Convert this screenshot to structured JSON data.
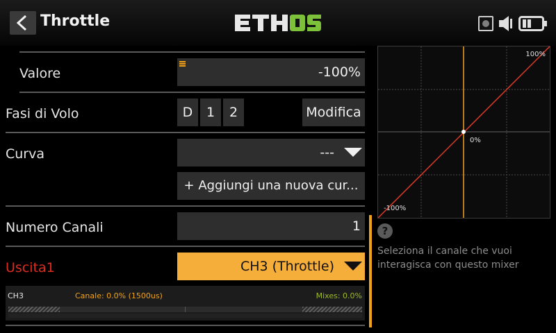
{
  "header": {
    "title": "Throttle",
    "logo_text": "ETHOS"
  },
  "form": {
    "value_label": "Valore",
    "value": "-100%",
    "flight_modes_label": "Fasi di Volo",
    "flight_modes": [
      "D",
      "1",
      "2"
    ],
    "edit_button": "Modifica",
    "curve_label": "Curva",
    "curve_value": "---",
    "add_curve_button": "+ Aggiungi una nuova cur...",
    "channel_count_label": "Numero Canali",
    "channel_count": "1",
    "output_label": "Uscita1",
    "output_value": "CH3 (Throttle)"
  },
  "monitor": {
    "channel": "CH3",
    "channel_value": "Canale: 0.0% (1500us)",
    "mixes_value": "Mixes: 0.0%"
  },
  "curve_preview": {
    "max_label": "100%",
    "center_label": "0%",
    "min_label": "-100%"
  },
  "help": {
    "icon_glyph": "?",
    "text": "Seleziona il canale che vuoi interagisca con questo mixer"
  },
  "colors": {
    "accent": "#f6ae3a",
    "error_label": "#e02b20",
    "curve_line": "#e03a2a",
    "logo_green": "#7dc03a",
    "mixes_green": "#9dbb2a"
  }
}
